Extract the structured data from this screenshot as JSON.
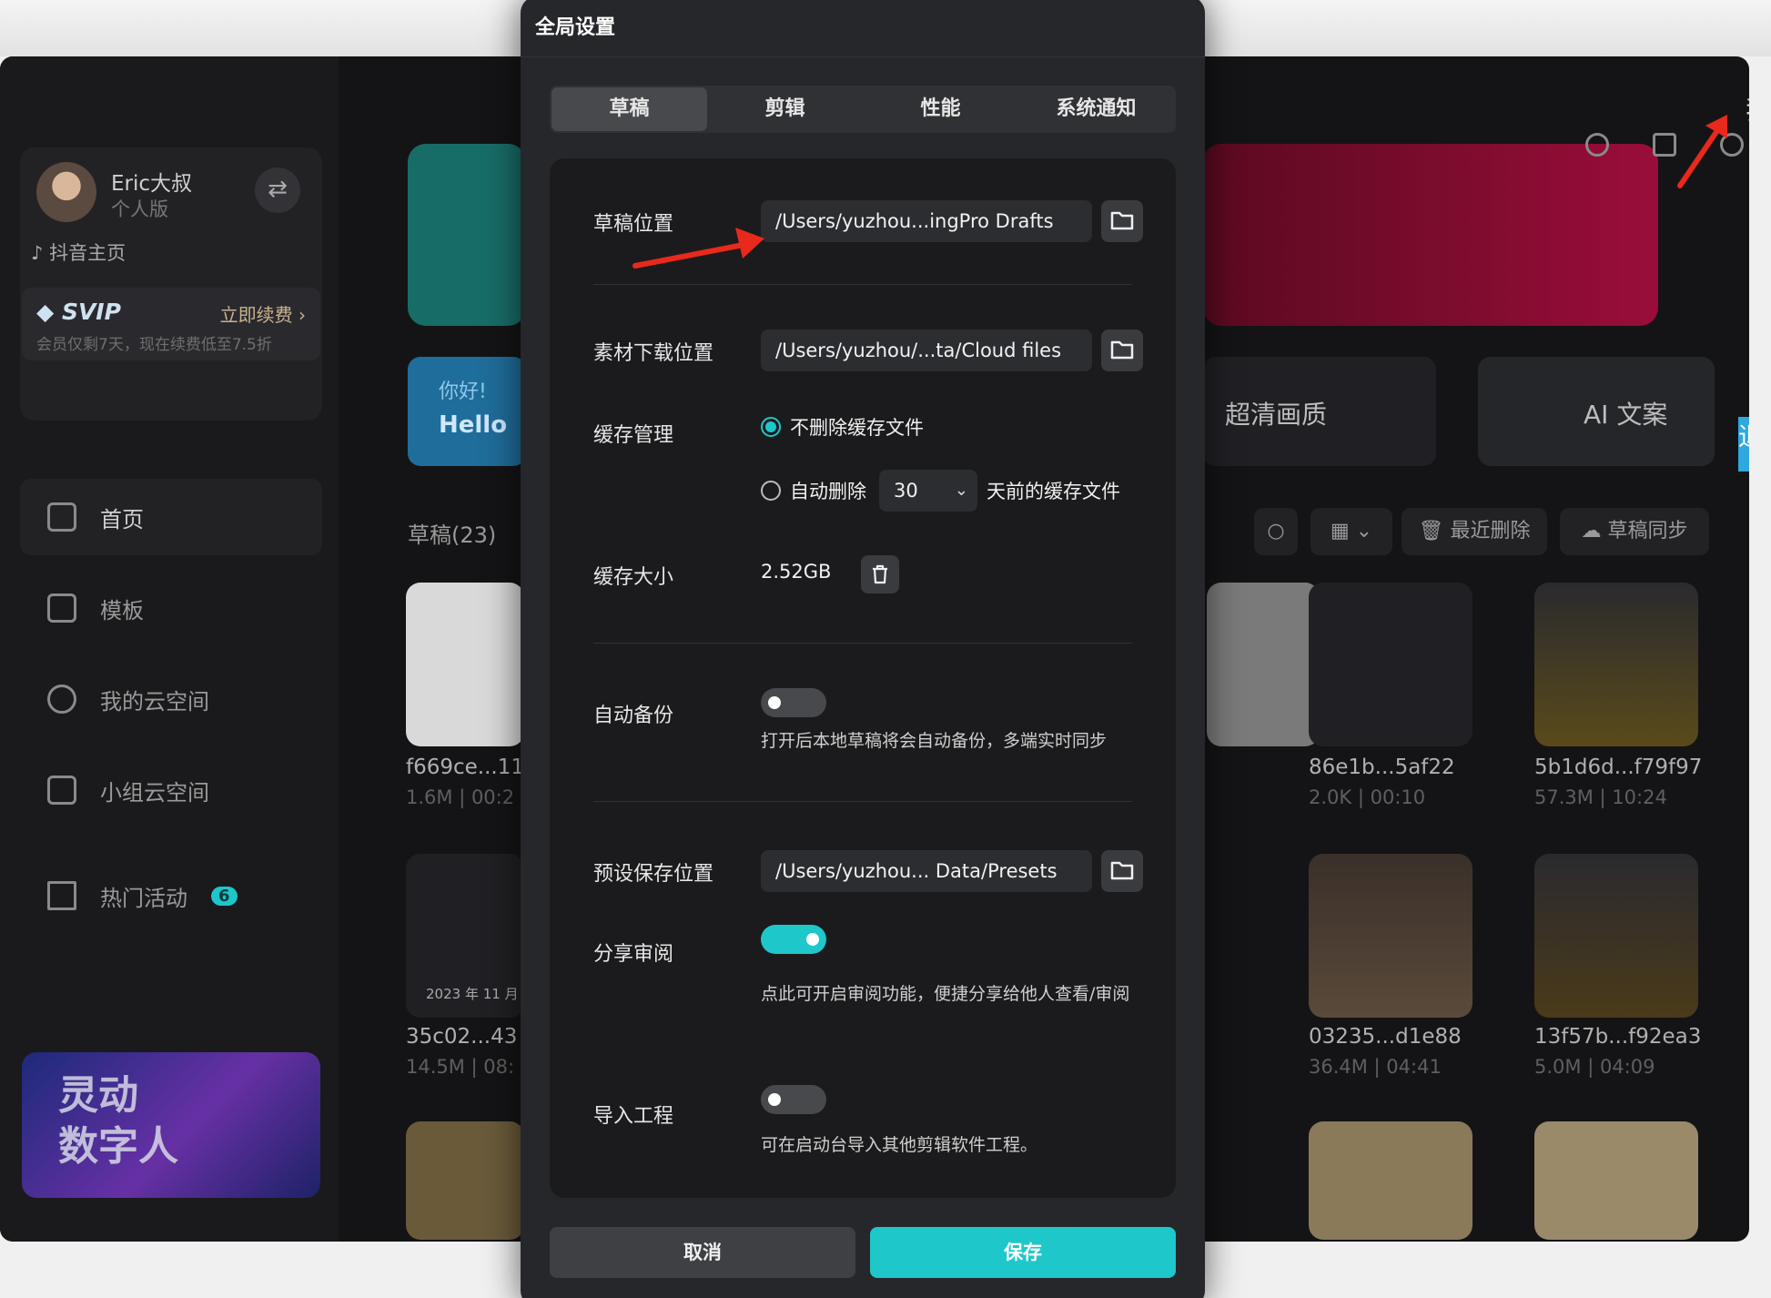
{
  "background_app": {
    "user": {
      "name": "Eric大叔",
      "edition": "个人版"
    },
    "douyin_link": "抖音主页",
    "svip": {
      "label": "SVIP",
      "renew": "立即续费",
      "note": "会员仅剩7天，现在续费低至7.5折"
    },
    "nav": [
      {
        "label": "首页",
        "icon": "home-icon"
      },
      {
        "label": "模板",
        "icon": "template-icon"
      },
      {
        "label": "我的云空间",
        "icon": "cloud-icon"
      },
      {
        "label": "小组云空间",
        "icon": "group-cloud-icon"
      },
      {
        "label": "热门活动",
        "icon": "flag-icon",
        "badge": "6"
      }
    ],
    "promo": {
      "line1": "灵动",
      "line2": "数字人"
    },
    "hello": {
      "line1": "你好!",
      "line2": "Hello"
    },
    "features": [
      "超清画质",
      "AI 文案"
    ],
    "side_tabs": [
      "我",
      "退"
    ],
    "drafts_title": "草稿(23)",
    "toolbar": {
      "recent_deleted": "最近删除",
      "draft_sync": "草稿同步"
    },
    "drafts": [
      {
        "name": "f669ce...11",
        "meta": "1.6M | 00:2"
      },
      {
        "name": "86e1b...5af22",
        "meta": "2.0K | 00:10"
      },
      {
        "name": "5b1d6d...f79f97",
        "meta": "57.3M | 10:24"
      },
      {
        "name": "35c02...43",
        "meta": "14.5M | 08:"
      },
      {
        "name": "03235...d1e88",
        "meta": "36.4M | 04:41"
      },
      {
        "name": "13f57b...f92ea3",
        "meta": "5.0M | 04:09"
      }
    ],
    "thumb_date": "2023 年 11 月"
  },
  "dialog": {
    "title": "全局设置",
    "tabs": [
      "草稿",
      "剪辑",
      "性能",
      "系统通知"
    ],
    "active_tab": "草稿",
    "draft_location": {
      "label": "草稿位置",
      "value": "/Users/yuzhou...ingPro Drafts"
    },
    "download_location": {
      "label": "素材下载位置",
      "value": "/Users/yuzhou/...ta/Cloud files"
    },
    "cache": {
      "label": "缓存管理",
      "option_keep": "不删除缓存文件",
      "option_auto": "自动删除",
      "days": "30",
      "days_suffix": "天前的缓存文件",
      "selected": "option_keep"
    },
    "cache_size": {
      "label": "缓存大小",
      "value": "2.52GB"
    },
    "auto_backup": {
      "label": "自动备份",
      "enabled": false,
      "hint": "打开后本地草稿将会自动备份，多端实时同步"
    },
    "preset_location": {
      "label": "预设保存位置",
      "value": "/Users/yuzhou... Data/Presets"
    },
    "share_review": {
      "label": "分享审阅",
      "enabled": true,
      "hint": "点此可开启审阅功能，便捷分享给他人查看/审阅"
    },
    "import_project": {
      "label": "导入工程",
      "enabled": false,
      "hint": "可在启动台导入其他剪辑软件工程。"
    },
    "cancel_label": "取消",
    "save_label": "保存"
  },
  "colors": {
    "accent": "#1ec7c9",
    "arrow": "#e8291c",
    "dialog_bg": "#26272a",
    "panel_bg": "#1b1b1d"
  }
}
